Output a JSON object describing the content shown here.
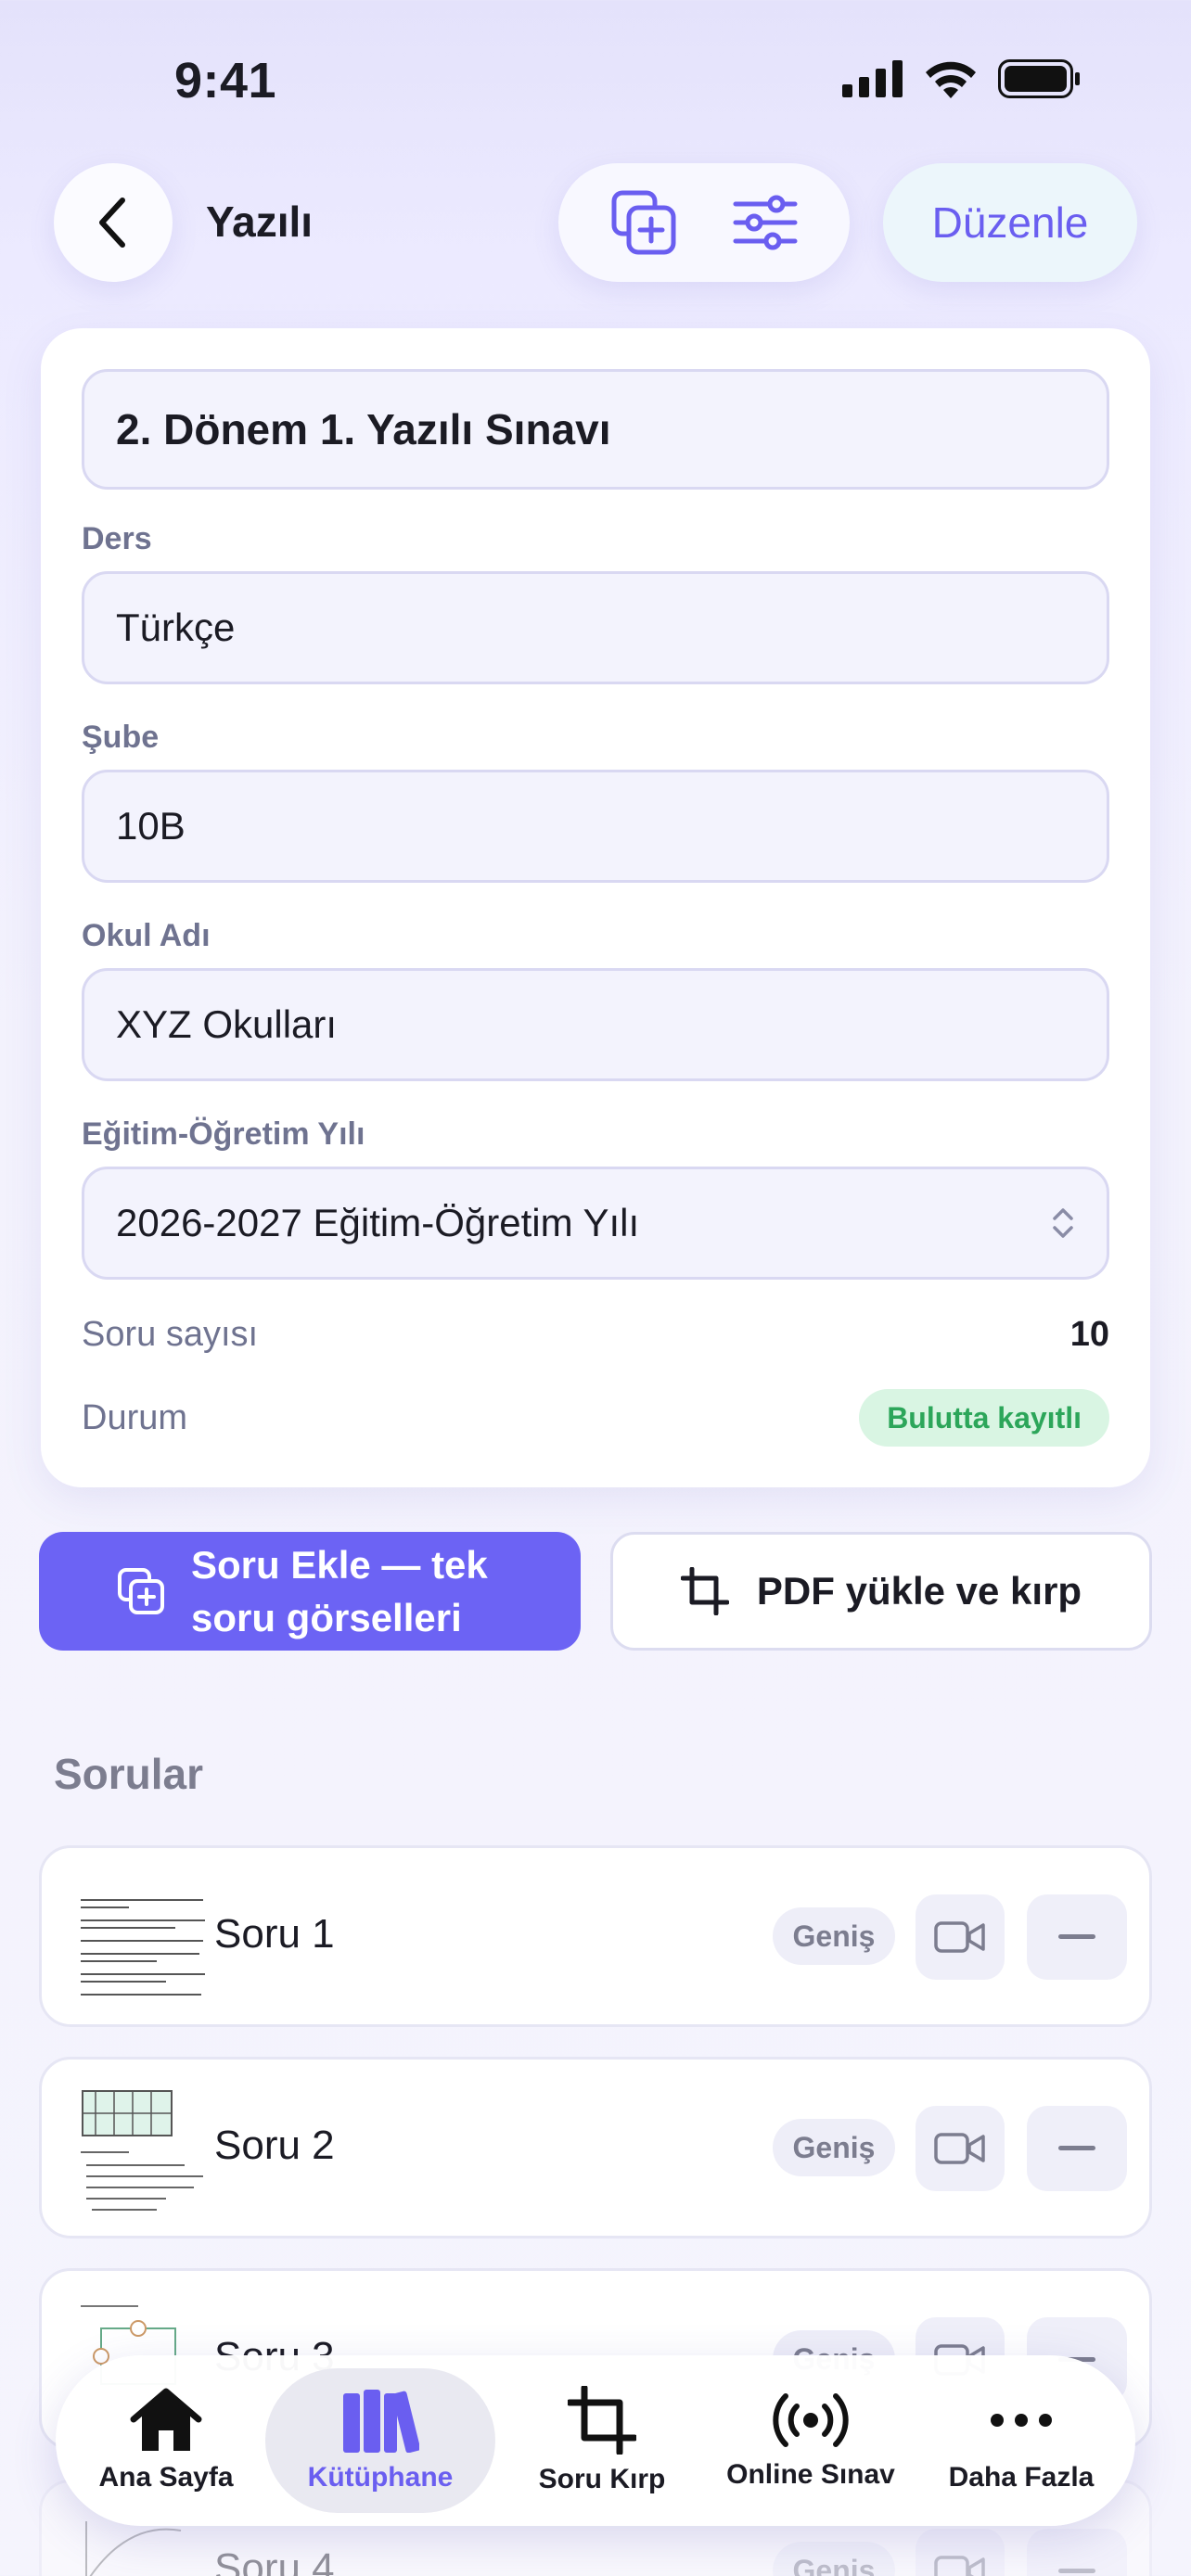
{
  "status_bar": {
    "time": "9:41"
  },
  "nav": {
    "title": "Yazılı",
    "edit_label": "Düzenle"
  },
  "form": {
    "exam_title": "2. Dönem 1. Yazılı Sınavı",
    "course_label": "Ders",
    "course_value": "Türkçe",
    "branch_label": "Şube",
    "branch_value": "10B",
    "school_label": "Okul Adı",
    "school_value": "XYZ Okulları",
    "year_label": "Eğitim-Öğretim Yılı",
    "year_value": "2026-2027 Eğitim-Öğretim Yılı",
    "question_count_label": "Soru sayısı",
    "question_count_value": "10",
    "status_label": "Durum",
    "status_value": "Bulutta kayıtlı"
  },
  "actions": {
    "add_label": "Soru Ekle — tek soru görselleri",
    "pdf_label": "PDF yükle ve kırp"
  },
  "questions": {
    "section_title": "Sorular",
    "items": [
      {
        "label": "Soru 1",
        "chip": "Geniş"
      },
      {
        "label": "Soru 2",
        "chip": "Geniş"
      },
      {
        "label": "Soru 3",
        "chip": "Geniş"
      },
      {
        "label": "Soru 4",
        "chip": "Geniş"
      }
    ]
  },
  "tabs": [
    {
      "label": "Ana Sayfa",
      "icon": "home-icon"
    },
    {
      "label": "Kütüphane",
      "icon": "library-icon",
      "active": true
    },
    {
      "label": "Soru Kırp",
      "icon": "crop-icon"
    },
    {
      "label": "Online Sınav",
      "icon": "broadcast-icon"
    },
    {
      "label": "Daha Fazla",
      "icon": "more-icon"
    }
  ],
  "colors": {
    "accent": "#6C63F4",
    "status_green": "#2CA65A",
    "status_green_bg": "#D9F5E3"
  }
}
